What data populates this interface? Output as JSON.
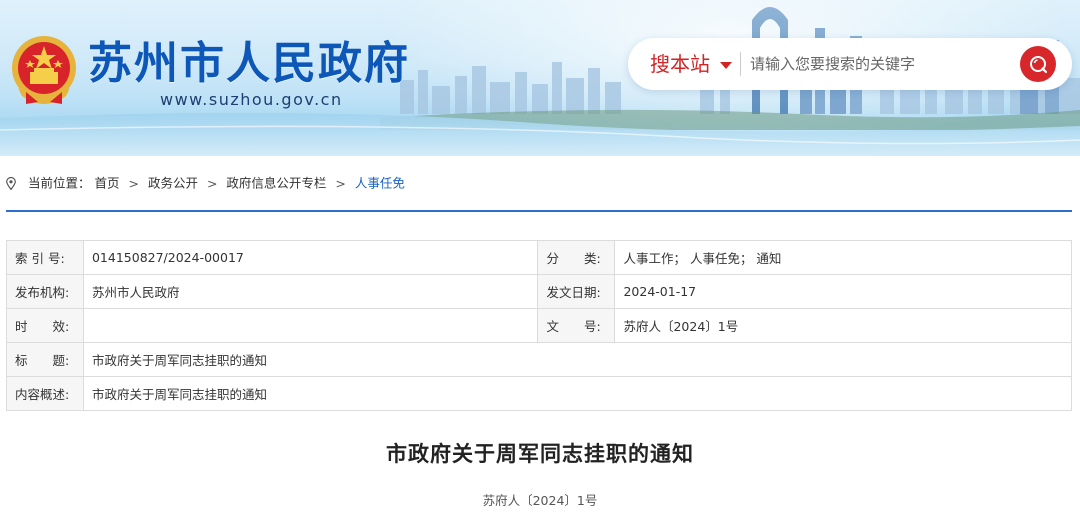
{
  "header": {
    "site_title": "苏州市人民政府",
    "site_url": "www.suzhou.gov.cn",
    "emblem_icon": "national-emblem-icon",
    "search": {
      "scope_label": "搜本站",
      "placeholder": "请输入您要搜索的关键字",
      "value": ""
    }
  },
  "breadcrumb": {
    "prefix": "当前位置：",
    "items": [
      "首页",
      "政务公开",
      "政府信息公开专栏",
      "人事任免"
    ],
    "separator": ">"
  },
  "meta": {
    "index_label": "索 引 号:",
    "index_value": "014150827/2024-00017",
    "category_label": "分　　类:",
    "category_value": "人事工作； 人事任免； 通知",
    "publisher_label": "发布机构:",
    "publisher_value": "苏州市人民政府",
    "date_label": "发文日期:",
    "date_value": "2024-01-17",
    "validity_label": "时　　效:",
    "validity_value": "",
    "docno_label": "文　　号:",
    "docno_value": "苏府人〔2024〕1号",
    "title_label": "标　　题:",
    "title_value": "市政府关于周军同志挂职的通知",
    "summary_label": "内容概述:",
    "summary_value": "市政府关于周军同志挂职的通知"
  },
  "article": {
    "title": "市政府关于周军同志挂职的通知",
    "doc_number": "苏府人〔2024〕1号"
  },
  "colors": {
    "brand_blue": "#0c57b8",
    "accent_red": "#d22325",
    "link_blue": "#1a63c6"
  }
}
